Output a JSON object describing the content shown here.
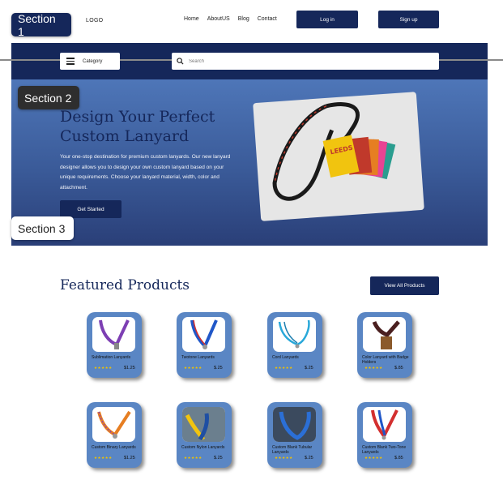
{
  "section_tags": [
    "Section 1",
    "Section 2",
    "Section 3"
  ],
  "header": {
    "logo": "LOGO",
    "nav": [
      "Home",
      "AboutUS",
      "Blog",
      "Contact"
    ],
    "login_label": "Log in",
    "signup_label": "Sign up"
  },
  "search_bar": {
    "category_label": "Category",
    "search_placeholder": "Search"
  },
  "hero": {
    "title": "Design Your Perfect Custom Lanyard",
    "description": "Your one-stop destination for premium custom lanyards. Our new lanyard designer allows you to design your own custom lanyard based on your unique requirements. Choose your lanyard material, width, color and attachment.",
    "cta_label": "Get Started",
    "image_text": "LEEDS"
  },
  "featured": {
    "title": "Featured Products",
    "view_all_label": "View All Products",
    "stars": "★★★★★",
    "products": [
      {
        "name": "Sublimation Lanyards",
        "price": "$1.25"
      },
      {
        "name": "Twotone Lanyards",
        "price": "$.25"
      },
      {
        "name": "Cord Lanyards",
        "price": "$.25"
      },
      {
        "name": "Color Lanyard with Badge Holders",
        "price": "$.85"
      },
      {
        "name": "Custom Binary Lanyards",
        "price": "$1.25"
      },
      {
        "name": "Custom Nylon Lanyards",
        "price": "$.25"
      },
      {
        "name": "Custom Blank Tubular Lanyards",
        "price": "$.25"
      },
      {
        "name": "Custom Blank Two-Tone Lanyards",
        "price": "$.85"
      }
    ]
  },
  "colors": {
    "navy": "#15275a",
    "card_blue": "#5a86c4",
    "hero_top": "#4e76b8",
    "hero_bottom": "#2a3f78",
    "star": "#f2c100"
  }
}
